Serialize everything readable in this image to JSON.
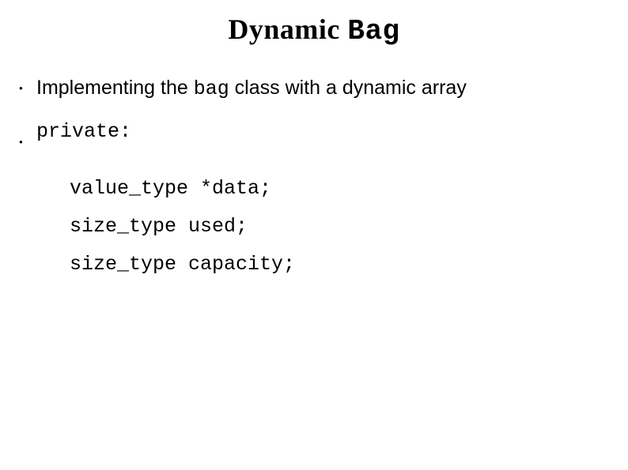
{
  "title": {
    "word1": "Dynamic ",
    "word2_code": "Bag"
  },
  "bullet1": {
    "pre": "Implementing the ",
    "code": "bag",
    "post": " class with a dynamic array"
  },
  "code": {
    "line1": "private:",
    "line2": "value_type *data;",
    "line3": "size_type used;",
    "line4": "size_type capacity;"
  }
}
